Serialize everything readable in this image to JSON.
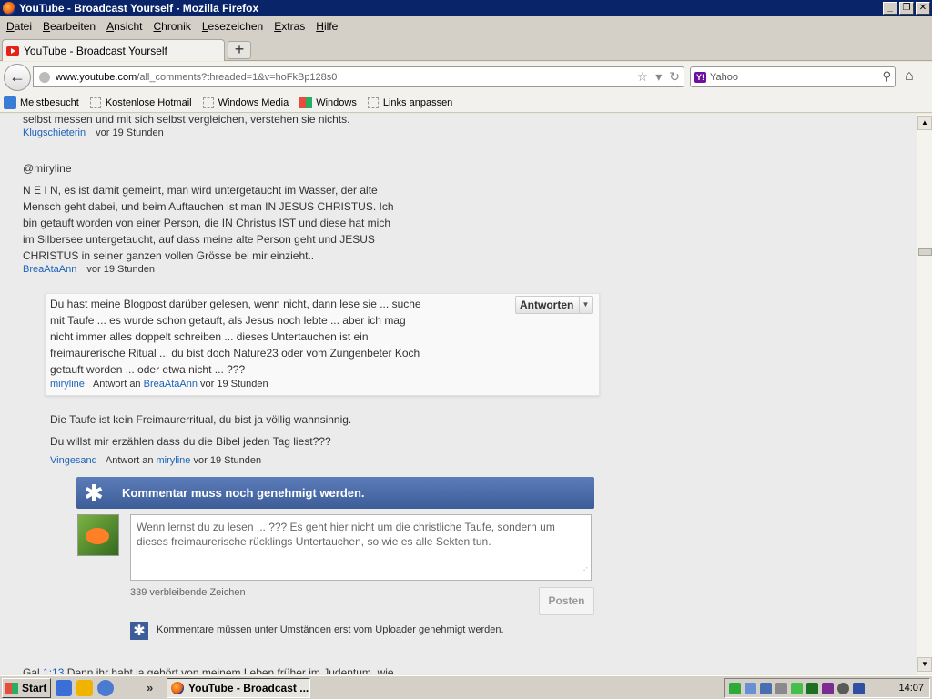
{
  "window": {
    "title": "YouTube - Broadcast Yourself - Mozilla Firefox"
  },
  "menu": [
    "Datei",
    "Bearbeiten",
    "Ansicht",
    "Chronik",
    "Lesezeichen",
    "Extras",
    "Hilfe"
  ],
  "tab": {
    "label": "YouTube - Broadcast Yourself",
    "new_tab": "+"
  },
  "nav": {
    "url_host": "www.youtube.com",
    "url_path": "/all_comments?threaded=1&v=hoFkBp128s0",
    "search_placeholder": "Yahoo",
    "yahoo_badge": "Y!"
  },
  "bookmarks": [
    "Meistbesucht",
    "Kostenlose Hotmail",
    "Windows Media",
    "Windows",
    "Links anpassen"
  ],
  "comments": {
    "top_cut": "selbst messen und mit sich selbst vergleichen, verstehen sie nichts.",
    "top_author": "Klugschieterin",
    "top_time": "vor 19 Stunden",
    "c1_mention": "@miryline",
    "c1_lines": [
      "N E I N, es ist damit gemeint, man wird untergetaucht im Wasser, der alte",
      "Mensch geht dabei, und beim Auftauchen ist man IN JESUS CHRISTUS. Ich",
      "bin getauft worden von einer Person, die IN Christus IST und diese hat mich",
      "im Silbersee untergetaucht, auf dass meine alte Person geht und JESUS",
      "CHRISTUS in seiner ganzen vollen Grösse bei mir einzieht.."
    ],
    "c1_author": "BreaAtaAnn",
    "c1_time": "vor 19 Stunden",
    "reply_lines": [
      "Du hast meine Blogpost darüber gelesen, wenn nicht, dann lese sie ... suche",
      "mit Taufe ... es wurde schon getauft, als Jesus noch lebte ... aber ich mag",
      "nicht immer alles doppelt schreiben ... dieses Untertauchen ist ein",
      "freimaurerische Ritual ... du bist doch Nature23 oder vom Zungenbeter Koch",
      "getauft worden ... oder etwa nicht ... ???"
    ],
    "reply_author": "miryline",
    "reply_to_label": "Antwort an",
    "reply_to": "BreaAtaAnn",
    "reply_time": "vor 19 Stunden",
    "reply_button": "Antworten",
    "c2_line1": "Die Taufe ist kein Freimaurerritual, du bist ja völlig wahnsinnig.",
    "c2_line2": "Du willst mir erzählen dass du die Bibel jeden Tag liest???",
    "c2_author": "Vingesand",
    "c2_to": "miryline",
    "c2_time": "vor 19 Stunden",
    "bottom_cut_prefix": "Gal",
    "bottom_cut_link": "1:13",
    "bottom_cut_rest": "Denn ihr habt ja gehört von meinem Leben früher im Judentum, wie"
  },
  "composer": {
    "banner": "Kommentar muss noch genehmigt werden.",
    "text": "Wenn lernst du zu lesen ... ??? Es geht hier nicht um die christliche Taufe, sondern um dieses freimaurerische rücklings Untertauchen, so wie es alle Sekten tun.",
    "chars_left": "339 verbleibende Zeichen",
    "post_button": "Posten",
    "notice": "Kommentare müssen unter Umständen erst vom Uploader genehmigt werden."
  },
  "taskbar": {
    "start": "Start",
    "task": "YouTube - Broadcast ...",
    "more": "»",
    "clock": "14:07"
  }
}
